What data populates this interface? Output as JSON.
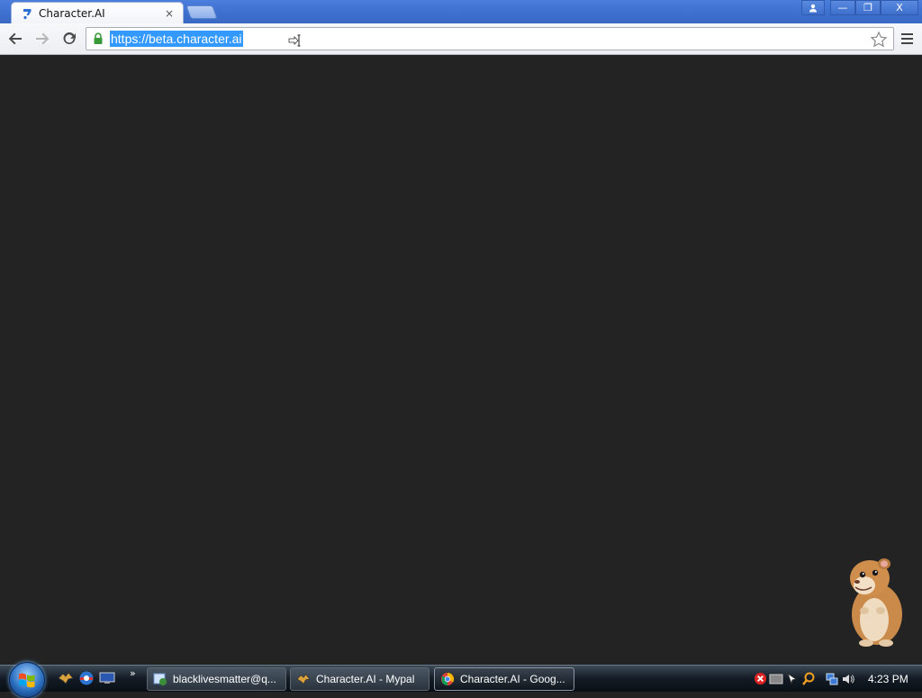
{
  "browser": {
    "tab_title": "Character.AI",
    "tab_close": "×",
    "url": "https://beta.character.ai",
    "window_controls": {
      "minimize": "—",
      "restore": "❐",
      "close": "X"
    }
  },
  "taskbar": {
    "tasks": [
      {
        "label": "blacklivesmatter@q...",
        "icon": "messenger-icon"
      },
      {
        "label": "Character.AI - Mypal",
        "icon": "mypal-icon"
      },
      {
        "label": "Character.AI - Goog...",
        "icon": "chrome-icon"
      }
    ],
    "quick_launch_more": "»",
    "clock": "4:23 PM"
  },
  "colors": {
    "page_background": "#232323",
    "selection": "#3399ff",
    "titlebar": "#3d6fce"
  }
}
